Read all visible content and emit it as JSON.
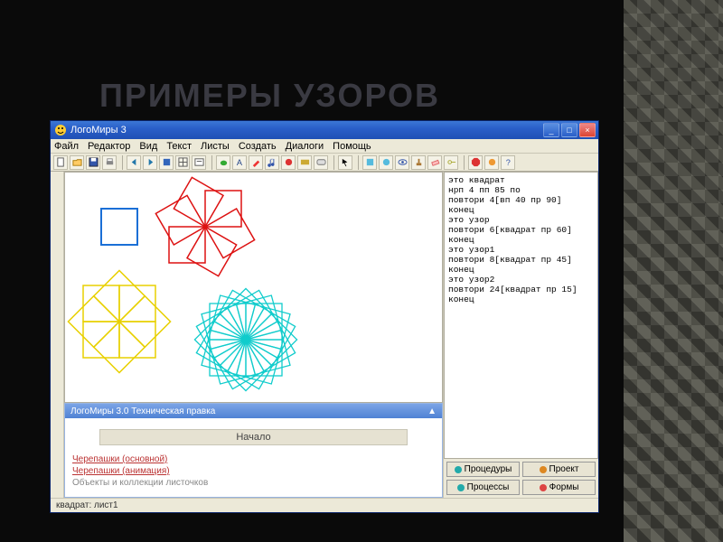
{
  "slide": {
    "title": "ПРИМЕРЫ УЗОРОВ"
  },
  "titlebar": {
    "text": "ЛогоМиры 3"
  },
  "window_controls": {
    "min": "_",
    "max": "□",
    "close": "×"
  },
  "menu": [
    "Файл",
    "Редактор",
    "Вид",
    "Текст",
    "Листы",
    "Создать",
    "Диалоги",
    "Помощь"
  ],
  "code_lines": [
    "это квадрат",
    "нрп 4 пп 85 по",
    "повтори 4[вп 40 пр 90]",
    "конец",
    "это узор",
    "повтори 6[квадрат пр 60]",
    "конец",
    "это узор1",
    "повтори 8[квадрат пр 45]",
    "конец",
    "это узор2",
    "повтори 24[квадрат пр 15]",
    "конец"
  ],
  "side_buttons": {
    "procedures": "Процедуры",
    "project": "Проект",
    "processes": "Процессы",
    "forms": "Формы"
  },
  "help": {
    "header": "ЛогоМиры 3.0 Техническая правка",
    "start": "Начало",
    "link1": "Черепашки (основной)",
    "link2": "Черепашки (анимация)",
    "link3": "Объекты и коллекции листочков"
  },
  "status": {
    "text": "квадрат: лист1"
  }
}
